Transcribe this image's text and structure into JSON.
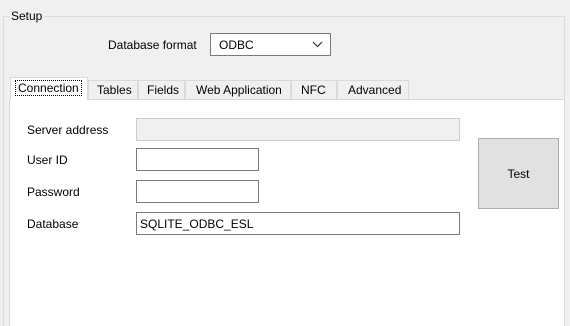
{
  "setup": {
    "group_label": "Setup",
    "database_format_label": "Database format",
    "database_format_value": "ODBC"
  },
  "tabs": [
    {
      "label": "Connection",
      "active": true
    },
    {
      "label": "Tables",
      "active": false
    },
    {
      "label": "Fields",
      "active": false
    },
    {
      "label": "Web Application",
      "active": false
    },
    {
      "label": "NFC",
      "active": false
    },
    {
      "label": "Advanced",
      "active": false
    }
  ],
  "connection": {
    "server_address_label": "Server address",
    "server_address_value": "",
    "server_address_enabled": false,
    "user_id_label": "User ID",
    "user_id_value": "",
    "password_label": "Password",
    "password_value": "",
    "database_label": "Database",
    "database_value": "SQLITE_ODBC_ESL",
    "test_button_label": "Test"
  },
  "icons": {
    "dropdown_chevron": "chevron-down-icon"
  }
}
